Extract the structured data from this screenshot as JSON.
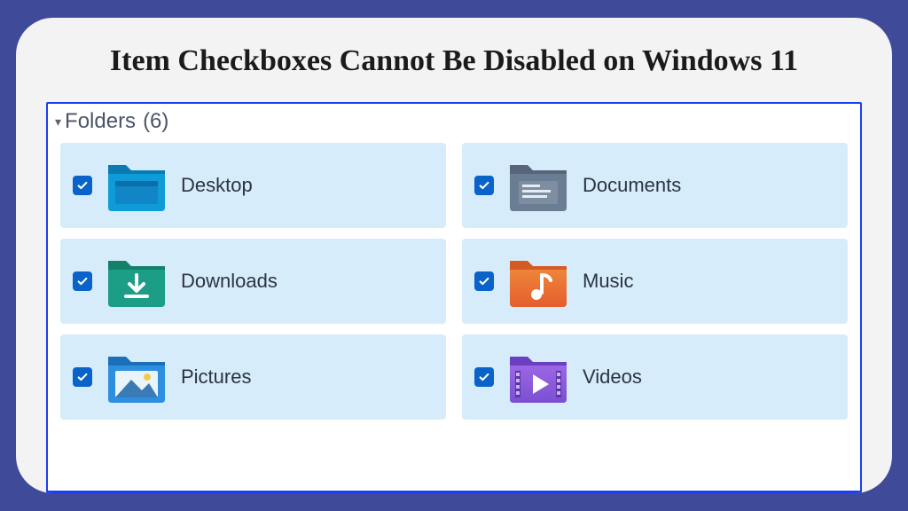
{
  "title": "Item Checkboxes Cannot Be Disabled on Windows 11",
  "group": {
    "label": "Folders",
    "count": "(6)"
  },
  "folders": [
    {
      "label": "Desktop",
      "icon": "desktop",
      "checked": true
    },
    {
      "label": "Documents",
      "icon": "documents",
      "checked": true
    },
    {
      "label": "Downloads",
      "icon": "downloads",
      "checked": true
    },
    {
      "label": "Music",
      "icon": "music",
      "checked": true
    },
    {
      "label": "Pictures",
      "icon": "pictures",
      "checked": true
    },
    {
      "label": "Videos",
      "icon": "videos",
      "checked": true
    }
  ],
  "colors": {
    "page_bg": "#3f4a99",
    "selection_bg": "#d7ecfa",
    "checkbox_bg": "#0a63c9",
    "border": "#1a3ef0"
  }
}
